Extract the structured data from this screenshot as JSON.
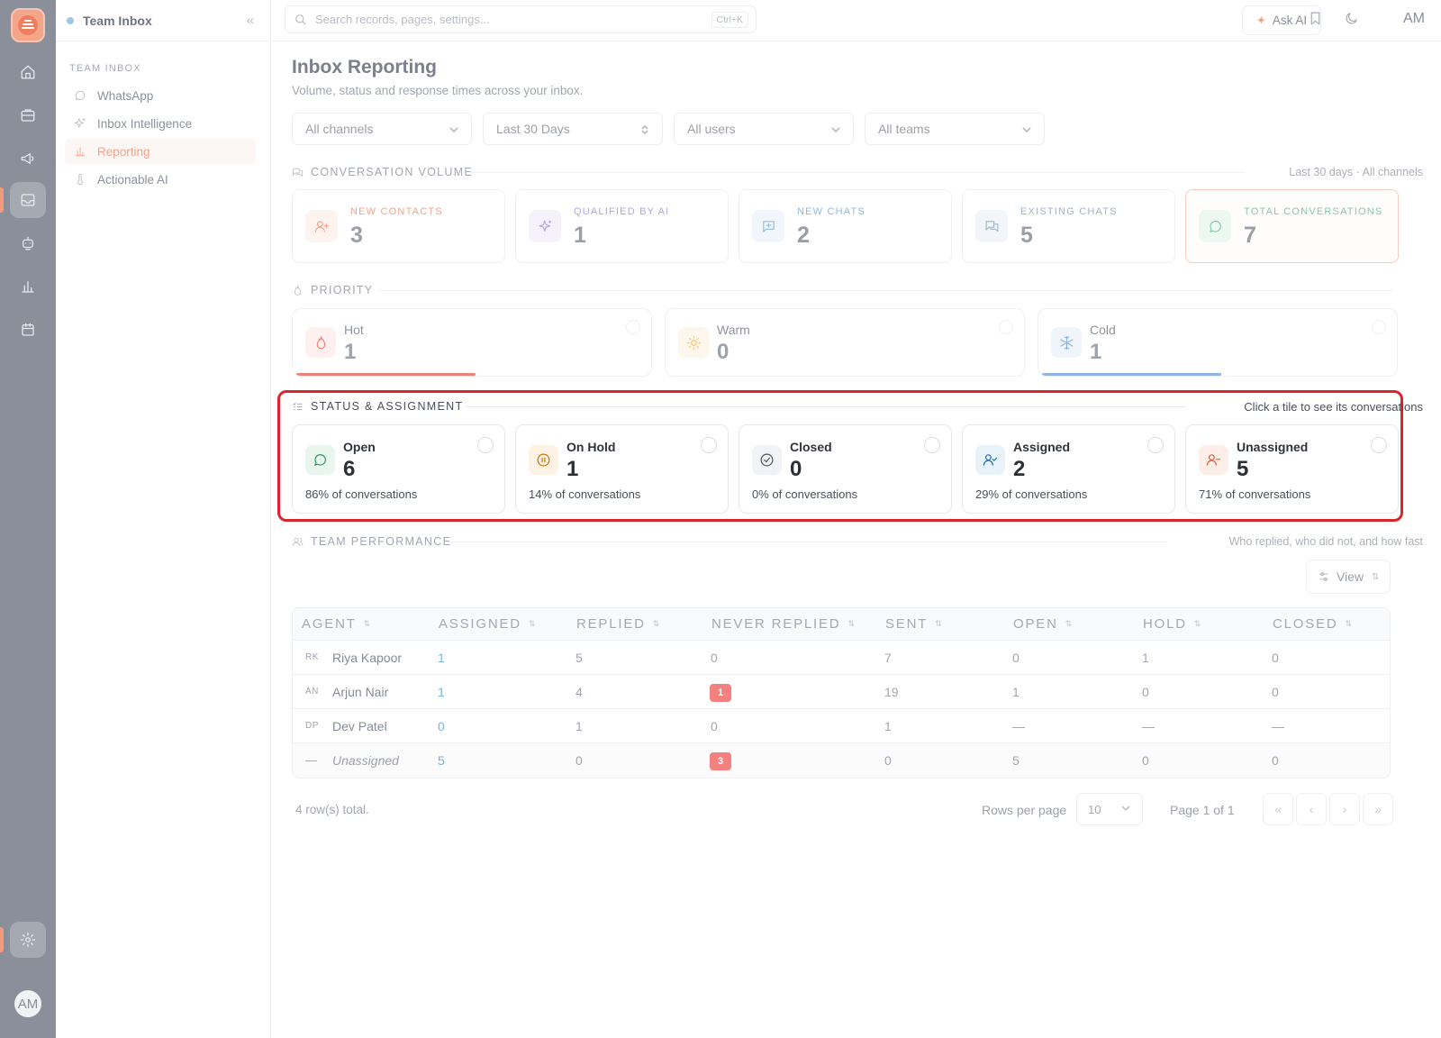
{
  "rail": {
    "items": [
      "home-icon",
      "inbox-tray-icon",
      "megaphone-icon",
      "inbox-icon",
      "bot-icon",
      "bar-chart-icon",
      "calendar-icon"
    ],
    "active": "inbox-icon",
    "user_initials": "AM"
  },
  "sidebar": {
    "title": "Team Inbox",
    "section": "TEAM INBOX",
    "items": [
      {
        "label": "WhatsApp",
        "icon": "whatsapp-icon"
      },
      {
        "label": "Inbox Intelligence",
        "icon": "sparkle-icon"
      },
      {
        "label": "Reporting",
        "icon": "bar-chart-icon",
        "active": true
      },
      {
        "label": "Actionable AI",
        "icon": "thermometer-icon"
      }
    ]
  },
  "topbar": {
    "search_placeholder": "Search records, pages, settings...",
    "shortcut": "Ctrl+K",
    "ask_ai": "Ask AI",
    "user_initials": "AM"
  },
  "page": {
    "title": "Inbox Reporting",
    "subtitle": "Volume, status and response times across your inbox."
  },
  "filters": [
    "All channels",
    "Last 30 Days",
    "All users",
    "All teams"
  ],
  "volume": {
    "label": "CONVERSATION VOLUME",
    "note": "Last 30 days · All channels",
    "cards": [
      {
        "label": "NEW CONTACTS",
        "value": "3",
        "color": "#f3a48b"
      },
      {
        "label": "QUALIFIED BY AI",
        "value": "1",
        "color": "#b4a3e6"
      },
      {
        "label": "NEW CHATS",
        "value": "2",
        "color": "#8fbbe0"
      },
      {
        "label": "EXISTING CHATS",
        "value": "5",
        "color": "#9fb2cc"
      },
      {
        "label": "TOTAL CONVERSATIONS",
        "value": "7",
        "color": "#86c9a4"
      }
    ]
  },
  "priority": {
    "label": "PRIORITY",
    "cards": [
      {
        "label": "Hot",
        "value": "1",
        "color": "#ee8077",
        "fill": 0.5
      },
      {
        "label": "Warm",
        "value": "0",
        "color": "#f3c07a",
        "fill": 0
      },
      {
        "label": "Cold",
        "value": "1",
        "color": "#8fb4e0",
        "fill": 0.5
      }
    ]
  },
  "status": {
    "label": "STATUS & ASSIGNMENT",
    "note": "Click a tile to see its conversations",
    "cards": [
      {
        "label": "Open",
        "value": "6",
        "pct": "86% of conversations"
      },
      {
        "label": "On Hold",
        "value": "1",
        "pct": "14% of conversations"
      },
      {
        "label": "Closed",
        "value": "0",
        "pct": "0% of conversations"
      },
      {
        "label": "Assigned",
        "value": "2",
        "pct": "29% of conversations"
      },
      {
        "label": "Unassigned",
        "value": "5",
        "pct": "71% of conversations"
      }
    ]
  },
  "team": {
    "label": "TEAM PERFORMANCE",
    "note": "Who replied, who did not, and how fast",
    "view_label": "View",
    "columns": [
      "AGENT",
      "ASSIGNED",
      "REPLIED",
      "NEVER REPLIED",
      "SENT",
      "OPEN",
      "HOLD",
      "CLOSED"
    ],
    "rows": [
      {
        "initials": "RK",
        "name": "Riya Kapoor",
        "assigned": "1",
        "replied": "5",
        "never": "0",
        "sent": "7",
        "open": "0",
        "hold": "1",
        "closed": "0"
      },
      {
        "initials": "AN",
        "name": "Arjun Nair",
        "assigned": "1",
        "replied": "4",
        "never": "1",
        "sent": "19",
        "open": "1",
        "hold": "0",
        "closed": "0"
      },
      {
        "initials": "DP",
        "name": "Dev Patel",
        "assigned": "0",
        "replied": "1",
        "never": "0",
        "sent": "1",
        "open": "—",
        "hold": "—",
        "closed": "—"
      },
      {
        "initials": "—",
        "name": "Unassigned",
        "assigned": "5",
        "replied": "0",
        "never": "3",
        "sent": "0",
        "open": "5",
        "hold": "0",
        "closed": "0"
      }
    ],
    "footer": {
      "total": "4 row(s) total.",
      "rows_per_page_label": "Rows per page",
      "rows_per_page": "10",
      "page_of": "Page 1 of 1"
    }
  }
}
